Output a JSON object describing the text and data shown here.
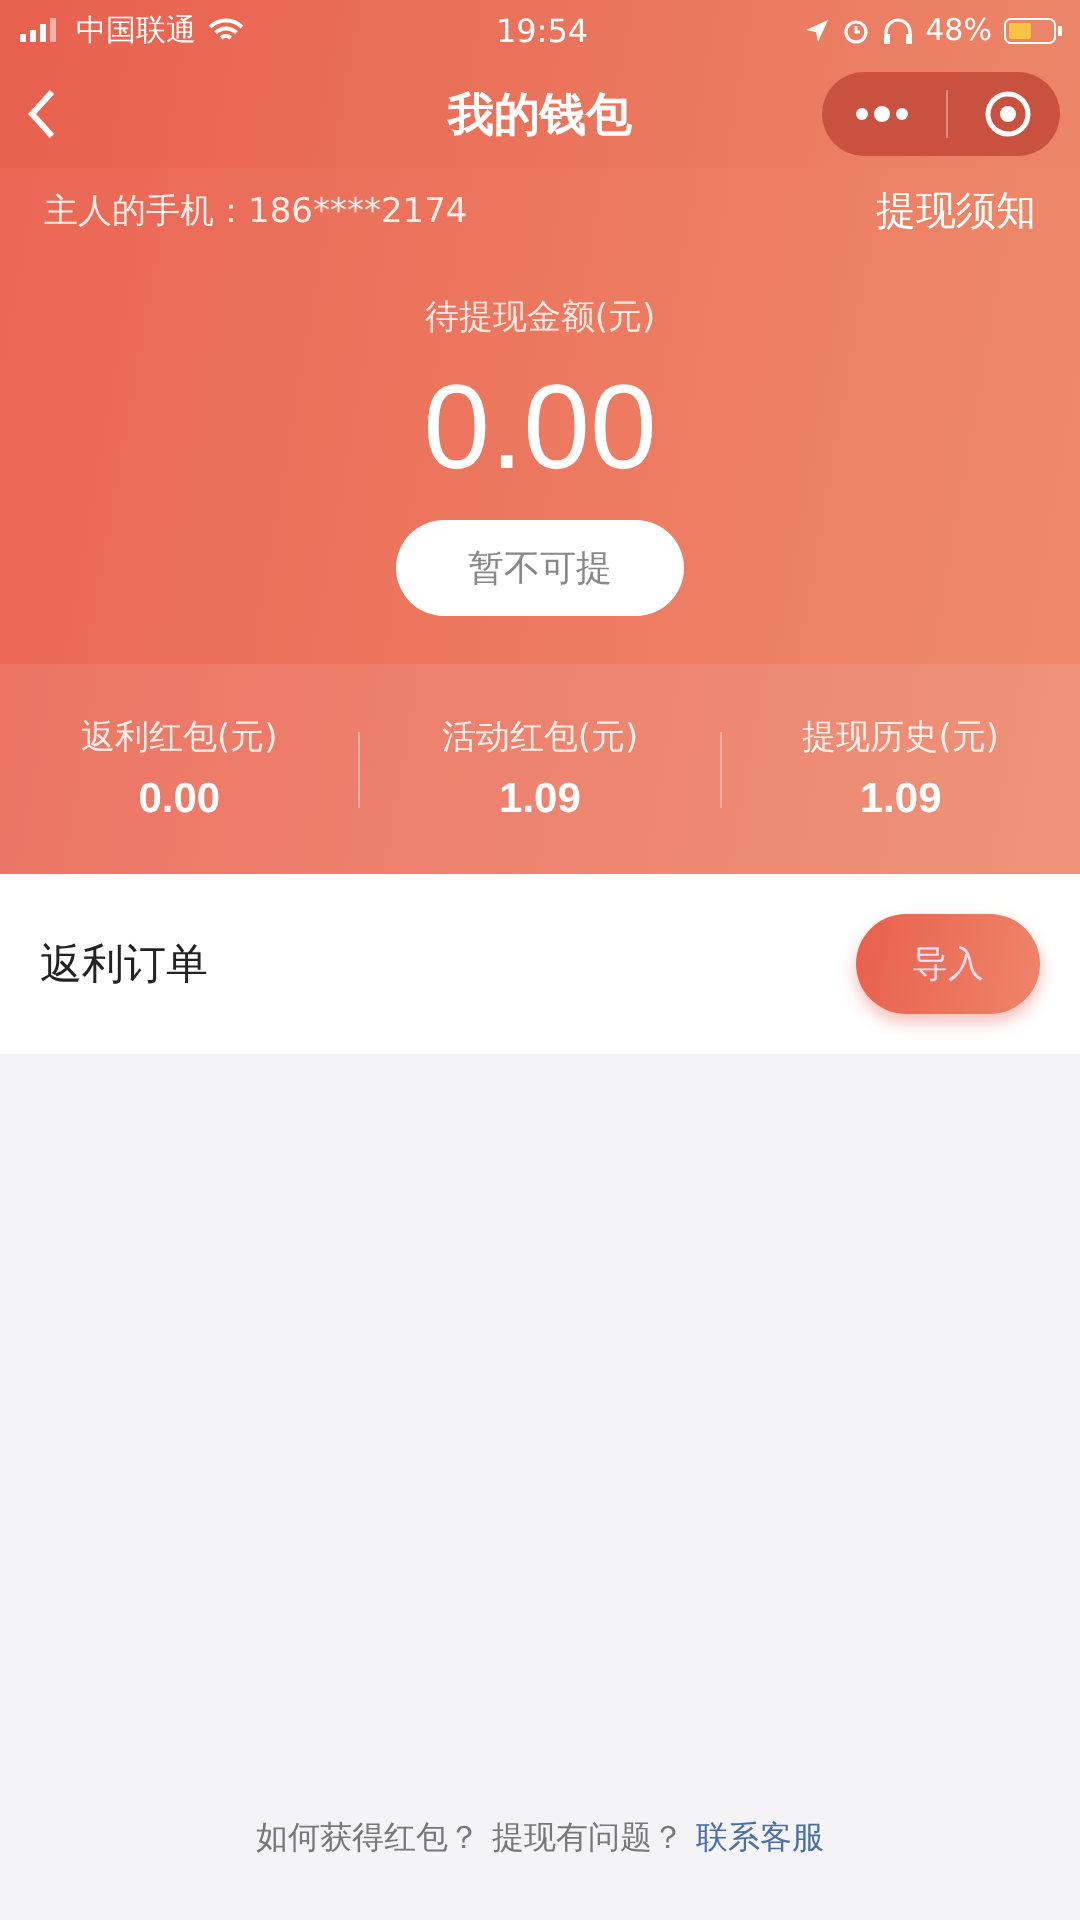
{
  "status_bar": {
    "carrier": "中国联通",
    "time": "19:54",
    "battery": "48%"
  },
  "nav": {
    "title": "我的钱包"
  },
  "wallet": {
    "owner_label": "主人的手机：186****2174",
    "notice_link": "提现须知",
    "balance_label": "待提现金额(元)",
    "balance": "0.00",
    "withdraw_button": {
      "label": "暂不可提",
      "disabled": true
    }
  },
  "stats": [
    {
      "label": "返利红包(元)",
      "value": "0.00"
    },
    {
      "label": "活动红包(元)",
      "value": "1.09"
    },
    {
      "label": "提现历史(元)",
      "value": "1.09"
    }
  ],
  "orders": {
    "title": "返利订单",
    "import_button": "导入"
  },
  "footer": {
    "question_1": "如何获得红包？",
    "question_2": "提现有问题？",
    "contact_link": "联系客服"
  }
}
